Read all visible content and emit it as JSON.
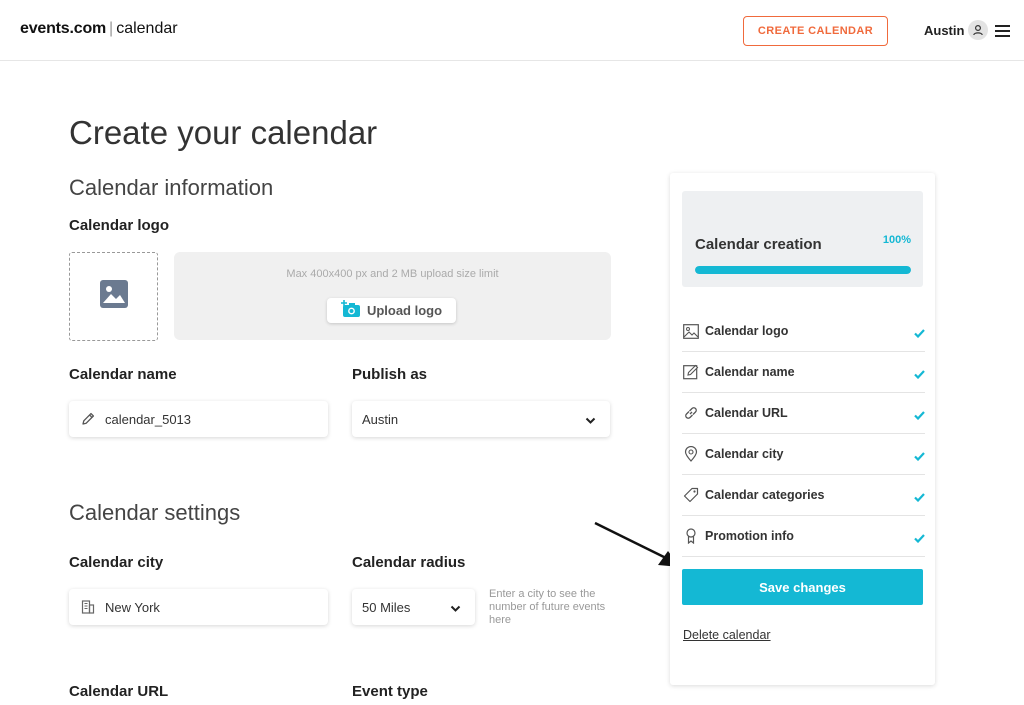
{
  "header": {
    "brand": "events.com",
    "separator": "|",
    "brand_sub": "calendar",
    "create_button": "CREATE CALENDAR",
    "user_name": "Austin",
    "user_icon": "user-icon",
    "menu_icon": "hamburger-menu-icon"
  },
  "page": {
    "title": "Create your calendar"
  },
  "calendar_information": {
    "section_title": "Calendar information",
    "logo_label": "Calendar logo",
    "logo_placeholder_icon": "image-icon",
    "upload_hint": "Max 400x400 px and 2 MB upload size limit",
    "upload_button": "Upload logo",
    "upload_icon": "camera-plus-icon",
    "name_label": "Calendar name",
    "name_value": "calendar_5013",
    "name_icon": "pencil-icon",
    "publish_label": "Publish as",
    "publish_value": "Austin"
  },
  "calendar_settings": {
    "section_title": "Calendar settings",
    "city_label": "Calendar city",
    "city_value": "New York",
    "city_icon": "building-icon",
    "radius_label": "Calendar radius",
    "radius_value": "50 Miles",
    "radius_hint": "Enter a city to see the number of future events here",
    "url_label": "Calendar URL",
    "event_type_label": "Event type"
  },
  "progress_panel": {
    "title": "Calendar creation",
    "percent_label": "100%",
    "percent_value": 100,
    "items": [
      {
        "label": "Calendar logo",
        "icon": "image-icon",
        "done": true
      },
      {
        "label": "Calendar name",
        "icon": "edit-icon",
        "done": true
      },
      {
        "label": "Calendar URL",
        "icon": "link-icon",
        "done": true
      },
      {
        "label": "Calendar city",
        "icon": "map-pin-icon",
        "done": true
      },
      {
        "label": "Calendar categories",
        "icon": "tag-icon",
        "done": true
      },
      {
        "label": "Promotion info",
        "icon": "award-icon",
        "done": true
      }
    ],
    "save_button": "Save changes",
    "delete_link": "Delete calendar"
  },
  "colors": {
    "accent": "#14b8d4",
    "create_button": "#f06a3c"
  }
}
